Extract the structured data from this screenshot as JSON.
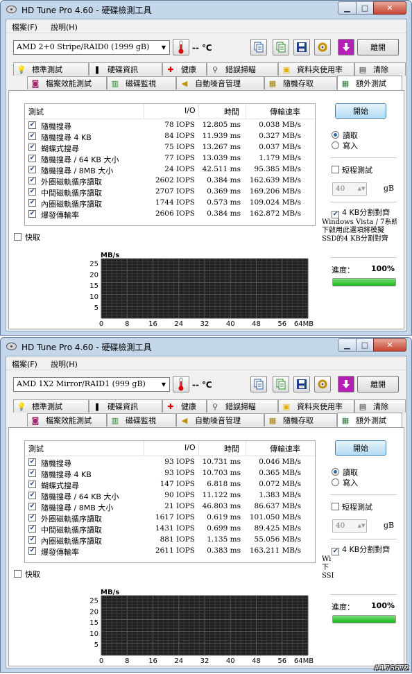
{
  "windows": [
    {
      "title": "HD Tune Pro 4.60 - 硬碟檢測工具",
      "menu": [
        "檔案(F)",
        "說明(H)"
      ],
      "drive": "AMD     2+0 Stripe/RAID0 (1999 gB)",
      "temperature": "-- ℃",
      "exit_label": "離開",
      "tabs_top": [
        "標準測試",
        "硬碟資訊",
        "健康",
        "錯誤掃瞄",
        "資料夾使用率",
        "清除"
      ],
      "tabs_bottom": [
        "檔案效能測試",
        "磁碟監視",
        "自動噪音管理",
        "隨機存取",
        "額外測試"
      ],
      "table_headers": {
        "test": "測試",
        "io": "I/O",
        "time": "時間",
        "rate": "傳輸速率"
      },
      "rows": [
        {
          "name": "隨機搜尋",
          "io": "78 IOPS",
          "time": "12.805 ms",
          "rate": "0.038 MB/s"
        },
        {
          "name": "隨機搜尋 4 KB",
          "io": "84 IOPS",
          "time": "11.939 ms",
          "rate": "0.327 MB/s"
        },
        {
          "name": "蝴蝶式搜尋",
          "io": "75 IOPS",
          "time": "13.267 ms",
          "rate": "0.037 MB/s"
        },
        {
          "name": "隨機搜尋 / 64 KB 大小",
          "io": "77 IOPS",
          "time": "13.039 ms",
          "rate": "1.179 MB/s"
        },
        {
          "name": "隨機搜尋 / 8MB 大小",
          "io": "24 IOPS",
          "time": "42.511 ms",
          "rate": "95.385 MB/s"
        },
        {
          "name": "外圈磁軌循序讀取",
          "io": "2602 IOPS",
          "time": "0.384 ms",
          "rate": "162.639 MB/s"
        },
        {
          "name": "中間磁軌循序讀取",
          "io": "2707 IOPS",
          "time": "0.369 ms",
          "rate": "169.206 MB/s"
        },
        {
          "name": "內圈磁軌循序讀取",
          "io": "1744 IOPS",
          "time": "0.573 ms",
          "rate": "109.024 MB/s"
        },
        {
          "name": "爆發傳輸率",
          "io": "2606 IOPS",
          "time": "0.384 ms",
          "rate": "162.872 MB/s"
        }
      ],
      "cache_label": "快取",
      "start_label": "開始",
      "read_label": "讀取",
      "write_label": "寫入",
      "short_test_label": "短程測試",
      "short_test_value": "40",
      "gb_label": "gB",
      "align_label": "4 KB分割對齊",
      "note_lines": [
        "Windows Vista / 7系統",
        "下啟用此選項將模擬",
        "SSD的4 KB分割對齊"
      ],
      "progress_label": "進度：",
      "progress_value": "100%",
      "progress_fraction": 1.0
    },
    {
      "title": "HD Tune Pro 4.60 - 硬碟檢測工具",
      "menu": [
        "檔案(F)",
        "說明(H)"
      ],
      "drive": "AMD     1X2 Mirror/RAID1 (999 gB)",
      "temperature": "-- ℃",
      "exit_label": "離開",
      "tabs_top": [
        "標準測試",
        "硬碟資訊",
        "健康",
        "錯誤掃瞄",
        "資料夾使用率",
        "清除"
      ],
      "tabs_bottom": [
        "檔案效能測試",
        "磁碟監視",
        "自動噪音管理",
        "隨機存取",
        "額外測試"
      ],
      "table_headers": {
        "test": "測試",
        "io": "I/O",
        "time": "時間",
        "rate": "傳輸速率"
      },
      "rows": [
        {
          "name": "隨機搜尋",
          "io": "93 IOPS",
          "time": "10.731 ms",
          "rate": "0.046 MB/s"
        },
        {
          "name": "隨機搜尋 4 KB",
          "io": "93 IOPS",
          "time": "10.703 ms",
          "rate": "0.365 MB/s"
        },
        {
          "name": "蝴蝶式搜尋",
          "io": "147 IOPS",
          "time": "6.818 ms",
          "rate": "0.072 MB/s"
        },
        {
          "name": "隨機搜尋 / 64 KB 大小",
          "io": "90 IOPS",
          "time": "11.122 ms",
          "rate": "1.383 MB/s"
        },
        {
          "name": "隨機搜尋 / 8MB 大小",
          "io": "21 IOPS",
          "time": "46.803 ms",
          "rate": "86.637 MB/s"
        },
        {
          "name": "外圈磁軌循序讀取",
          "io": "1617 IOPS",
          "time": "0.619 ms",
          "rate": "101.050 MB/s"
        },
        {
          "name": "中間磁軌循序讀取",
          "io": "1431 IOPS",
          "time": "0.699 ms",
          "rate": "89.425 MB/s"
        },
        {
          "name": "內圈磁軌循序讀取",
          "io": "881 IOPS",
          "time": "1.135 ms",
          "rate": "55.056 MB/s"
        },
        {
          "name": "爆發傳輸率",
          "io": "2611 IOPS",
          "time": "0.383 ms",
          "rate": "163.211 MB/s"
        }
      ],
      "cache_label": "快取",
      "start_label": "開始",
      "read_label": "讀取",
      "write_label": "寫入",
      "short_test_label": "短程測試",
      "short_test_value": "40",
      "gb_label": "gB",
      "align_label": "4 KB分割對齊",
      "note_lines": [
        "Wi",
        "下",
        "SSI"
      ],
      "progress_label": "進度：",
      "progress_value": "100%",
      "progress_fraction": 1.0
    }
  ],
  "chart": {
    "y_unit": "MB/s",
    "y_ticks": [
      "25",
      "20",
      "15",
      "10",
      "5"
    ],
    "x_ticks": [
      "0",
      "8",
      "16",
      "24",
      "32",
      "40",
      "48",
      "56",
      "64MB"
    ]
  },
  "watermark": "#176672"
}
